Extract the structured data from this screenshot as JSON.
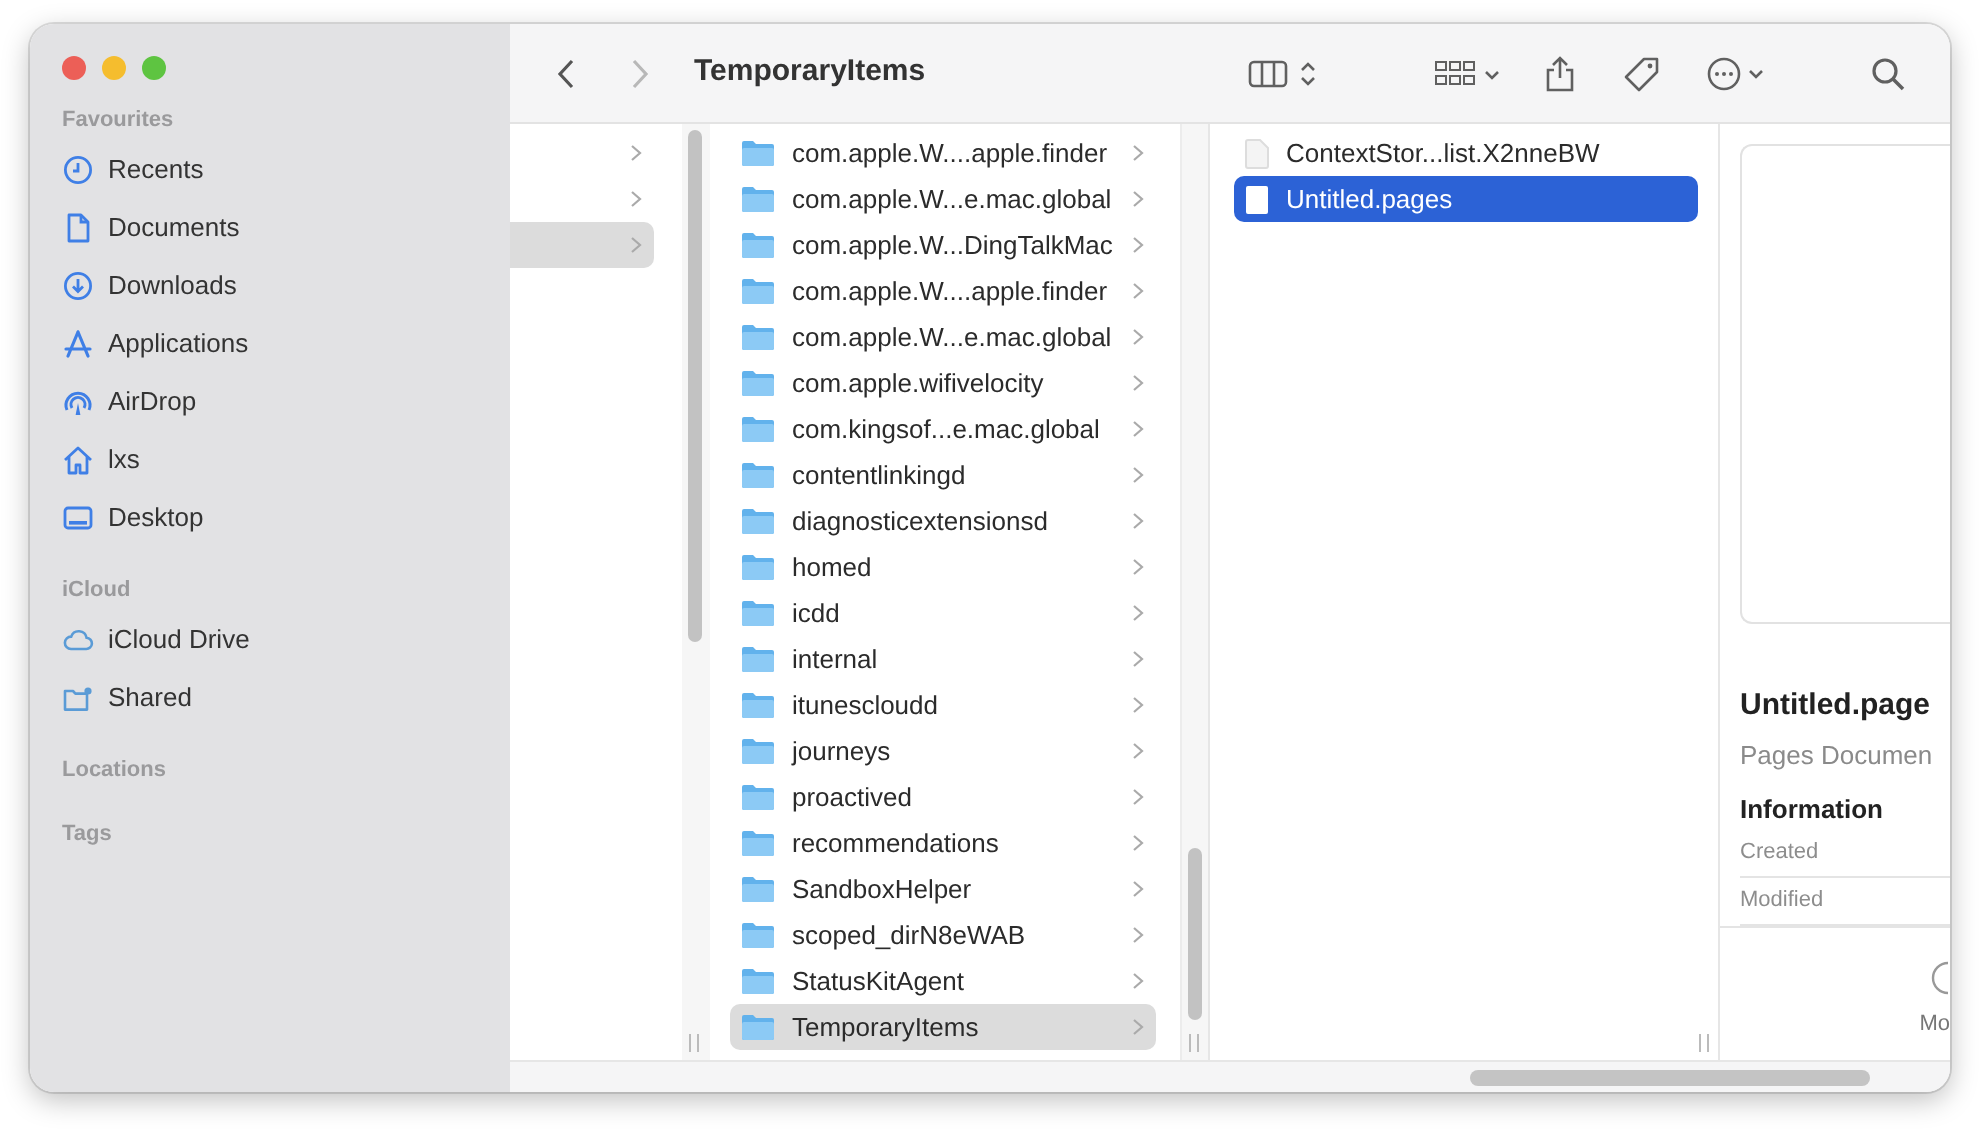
{
  "window": {
    "title": "TemporaryItems",
    "back": {
      "disabled": false
    },
    "forward": {
      "disabled": true
    }
  },
  "sidebar": {
    "sections": [
      {
        "heading": "Favourites",
        "items": [
          {
            "label": "Recents",
            "kind": "clock"
          },
          {
            "label": "Documents",
            "kind": "document"
          },
          {
            "label": "Downloads",
            "kind": "download"
          },
          {
            "label": "Applications",
            "kind": "apps"
          },
          {
            "label": "AirDrop",
            "kind": "airdrop"
          },
          {
            "label": "lxs",
            "kind": "home"
          },
          {
            "label": "Desktop",
            "kind": "desktop"
          }
        ]
      },
      {
        "heading": "iCloud",
        "items": [
          {
            "label": "iCloud Drive",
            "kind": "cloud"
          },
          {
            "label": "Shared",
            "kind": "shared"
          }
        ]
      },
      {
        "heading": "Locations"
      },
      {
        "heading": "Tags"
      }
    ]
  },
  "columns": [
    {
      "focused": false,
      "rows": [
        {
          "kind": "folder",
          "selected": false
        },
        {
          "kind": "folder",
          "selected": false
        },
        {
          "kind": "folder",
          "selected": true
        }
      ]
    },
    {
      "focused": false,
      "rows": [
        {
          "name": "com.apple.W....apple.finder",
          "kind": "folder",
          "selected": false
        },
        {
          "name": "com.apple.W...e.mac.global",
          "kind": "folder",
          "selected": false
        },
        {
          "name": "com.apple.W...DingTalkMac",
          "kind": "folder",
          "selected": false
        },
        {
          "name": "com.apple.W....apple.finder",
          "kind": "folder",
          "selected": false
        },
        {
          "name": "com.apple.W...e.mac.global",
          "kind": "folder",
          "selected": false
        },
        {
          "name": "com.apple.wifivelocity",
          "kind": "folder",
          "selected": false
        },
        {
          "name": "com.kingsof...e.mac.global",
          "kind": "folder",
          "selected": false
        },
        {
          "name": "contentlinkingd",
          "kind": "folder",
          "selected": false
        },
        {
          "name": "diagnosticextensionsd",
          "kind": "folder",
          "selected": false
        },
        {
          "name": "homed",
          "kind": "folder",
          "selected": false
        },
        {
          "name": "icdd",
          "kind": "folder",
          "selected": false
        },
        {
          "name": "internal",
          "kind": "folder",
          "selected": false
        },
        {
          "name": "itunescloudd",
          "kind": "folder",
          "selected": false
        },
        {
          "name": "journeys",
          "kind": "folder",
          "selected": false
        },
        {
          "name": "proactived",
          "kind": "folder",
          "selected": false
        },
        {
          "name": "recommendations",
          "kind": "folder",
          "selected": false
        },
        {
          "name": "SandboxHelper",
          "kind": "folder",
          "selected": false
        },
        {
          "name": "scoped_dirN8eWAB",
          "kind": "folder",
          "selected": false
        },
        {
          "name": "StatusKitAgent",
          "kind": "folder",
          "selected": false
        },
        {
          "name": "TemporaryItems",
          "kind": "folder",
          "selected": true
        }
      ]
    },
    {
      "focused": true,
      "rows": [
        {
          "name": "ContextStor...list.X2nneBW",
          "kind": "file",
          "selected": false
        },
        {
          "name": "Untitled.pages",
          "kind": "file",
          "selected": true
        }
      ]
    }
  ],
  "preview": {
    "title": "Untitled.page",
    "subtitle": "Pages Documen",
    "section": "Information",
    "fields": [
      {
        "label": "Created"
      },
      {
        "label": "Modified"
      }
    ],
    "actions": [
      {
        "label": "Mo"
      }
    ]
  }
}
